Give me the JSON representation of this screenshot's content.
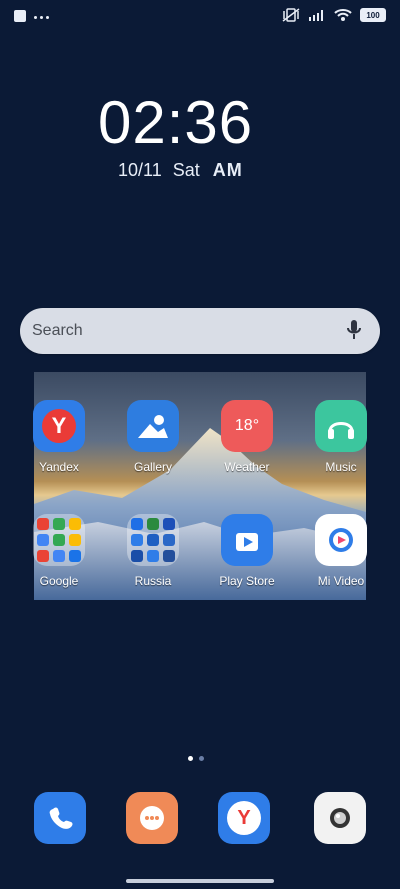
{
  "status_bar": {
    "battery_level": "100",
    "icons": [
      "square-icon",
      "more-icon",
      "vibrate-icon",
      "signal-icon",
      "wifi-icon",
      "battery-icon"
    ]
  },
  "widgets": {
    "clock_time": "02:36",
    "date": "10/11",
    "day": "Sat",
    "ampm": "AM"
  },
  "search": {
    "placeholder": "Search"
  },
  "apps": [
    {
      "label": "Yandex"
    },
    {
      "label": "Gallery"
    },
    {
      "label": "Weather",
      "icon_text": "18°"
    },
    {
      "label": "Music"
    },
    {
      "label": "Google"
    },
    {
      "label": "Russia"
    },
    {
      "label": "Play Store"
    },
    {
      "label": "Mi Video"
    }
  ],
  "dock": [
    {
      "name": "phone-app"
    },
    {
      "name": "messages-app"
    },
    {
      "name": "yandex-browser-app"
    },
    {
      "name": "camera-app"
    }
  ],
  "colors": {
    "background": "#0b1a36",
    "search_bg": "#d9dde6",
    "yandex_blue": "#2f7de8",
    "weather_red": "#ee5a5a",
    "music_green": "#3cc69e",
    "messages_orange": "#f08a57"
  },
  "page_indicator": {
    "pages": 2,
    "current": 1
  }
}
